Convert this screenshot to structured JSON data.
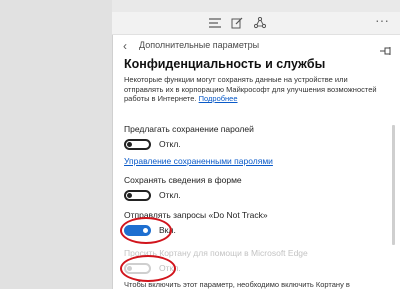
{
  "panel": {
    "title": "Дополнительные параметры",
    "back_glyph": "‹",
    "heading": "Конфиденциальность и службы",
    "description": "Некоторые функции могут сохранять данные на устройстве или отправлять их в корпорацию Майкрософт для улучшения возможностей работы в Интернете.",
    "description_link": "Подробнее"
  },
  "toolbar": {
    "more_glyph": "···",
    "icons": [
      "hub-icon",
      "web-note-icon",
      "share-icon"
    ]
  },
  "settings": {
    "passwords": {
      "label": "Предлагать сохранение паролей",
      "state": "Откл.",
      "on": false,
      "manage_link": "Управление сохраненными паролями"
    },
    "forms": {
      "label": "Сохранять сведения в форме",
      "state": "Откл.",
      "on": false
    },
    "dnt": {
      "label": "Отправлять запросы «Do Not Track»",
      "state": "Вкл.",
      "on": true
    },
    "cortana": {
      "label": "Просить Кортану для помощи в Microsoft Edge",
      "state": "Откл.",
      "on": false,
      "disabled": true,
      "note": "Чтобы включить этот параметр, необходимо включить Кортану в системе."
    }
  },
  "colors": {
    "accent": "#1e6fd0",
    "highlight": "#d1141c",
    "link": "#0a5ac8"
  }
}
